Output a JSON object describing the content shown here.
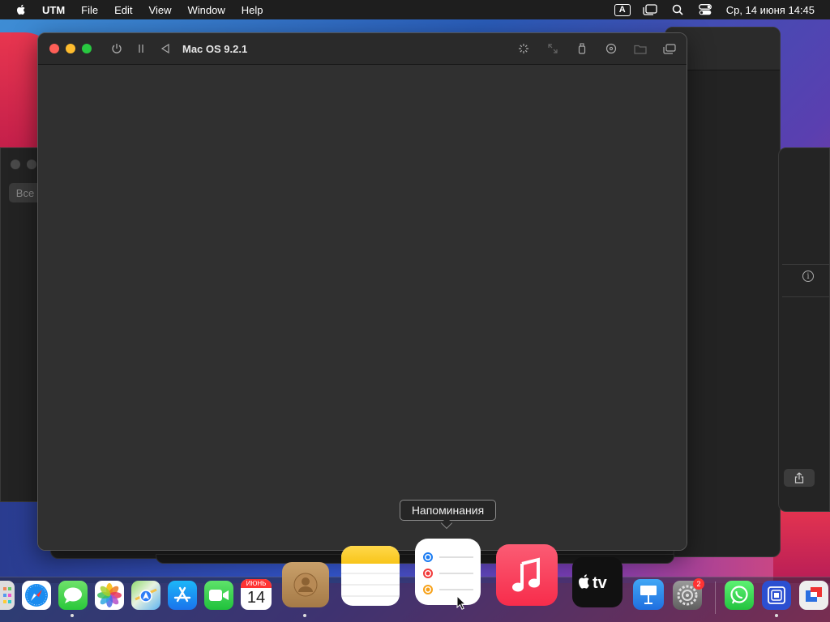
{
  "menubar": {
    "app_name": "UTM",
    "menus": [
      "File",
      "Edit",
      "View",
      "Window",
      "Help"
    ],
    "input_source": "A",
    "clock": "Ср, 14 июня  14:45"
  },
  "window": {
    "title": "Mac OS 9.2.1"
  },
  "bg_window": {
    "segment_label": "Все"
  },
  "tooltip": {
    "text": "Напоминания"
  },
  "dock": {
    "calendar_month": "ИЮНЬ",
    "calendar_day": "14",
    "settings_badge": "2",
    "items": [
      "launchpad-icon",
      "safari-icon",
      "messages-icon",
      "photos-icon",
      "maps-icon",
      "app-store-icon",
      "facetime-icon",
      "calendar-icon",
      "contacts-icon",
      "notes-icon",
      "reminders-icon",
      "music-icon",
      "apple-tv-icon",
      "keynote-icon",
      "system-preferences-icon",
      "whatsapp-icon",
      "utm-icon",
      "parallels-icon"
    ]
  },
  "colors": {
    "close": "#fe5f57",
    "minimize": "#febc2e",
    "zoom": "#28c840",
    "window_bg": "#2f2f2f"
  }
}
